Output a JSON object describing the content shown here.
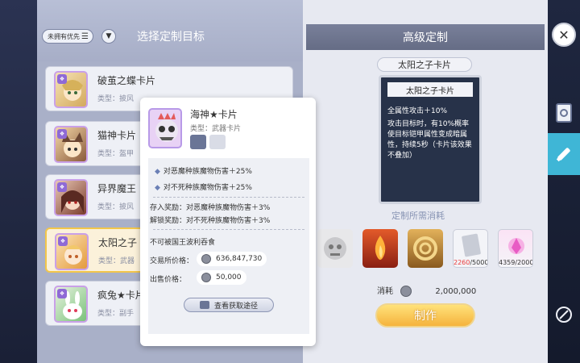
{
  "left_panel": {
    "filter_label": "未拥有优先",
    "title": "选择定制目标",
    "cards": [
      {
        "name": "破茧之蝶卡片",
        "type": "类型：披风"
      },
      {
        "name": "猫神卡片",
        "type": "类型：盔甲"
      },
      {
        "name": "异界魔王",
        "type": "类型：披风"
      },
      {
        "name": "太阳之子",
        "type": "类型：武器"
      },
      {
        "name": "疯兔★卡片",
        "type": "类型：副手"
      }
    ]
  },
  "popup": {
    "name": "海神★卡片",
    "type": "类型：武器卡片",
    "bonuses": [
      "对恶魔种族魔物伤害＋25%",
      "对不死种族魔物伤害＋25%"
    ],
    "deposit": "存入奖励：对恶魔种族魔物伤害＋3%",
    "unlock": "解锁奖励：对不死种族魔物伤害＋3%",
    "note": "不可被国王波利吞食",
    "exchange_label": "交易所价格：",
    "exchange_value": "636,847,730",
    "sell_label": "出售价格：",
    "sell_value": "50,000",
    "route_label": "查看获取途径"
  },
  "center": {
    "header": "高级定制",
    "card_ribbon": "太阳之子卡片",
    "card_title": "太阳之子卡片",
    "desc1": "全属性攻击＋10%",
    "desc2": "攻击目标时，有10%概率使目标铠甲属性变成暗属性，持续5秒（卡片该效果不叠加）",
    "cost_label": "定制所需消耗",
    "materials": [
      {
        "icon": "gray-mask",
        "count": ""
      },
      {
        "icon": "flame",
        "count": ""
      },
      {
        "icon": "spiral",
        "count": ""
      },
      {
        "icon": "silver-card",
        "count_have": "2260",
        "count_need": "/5000"
      },
      {
        "icon": "pink-crystal",
        "count": "4359/2000"
      }
    ],
    "consume_label": "消耗",
    "consume_value": "2,000,000",
    "make_label": "制作"
  },
  "colors": {
    "accent": "#3fb6d6",
    "gold": "#f5b33d",
    "danger": "#e83a3a"
  }
}
